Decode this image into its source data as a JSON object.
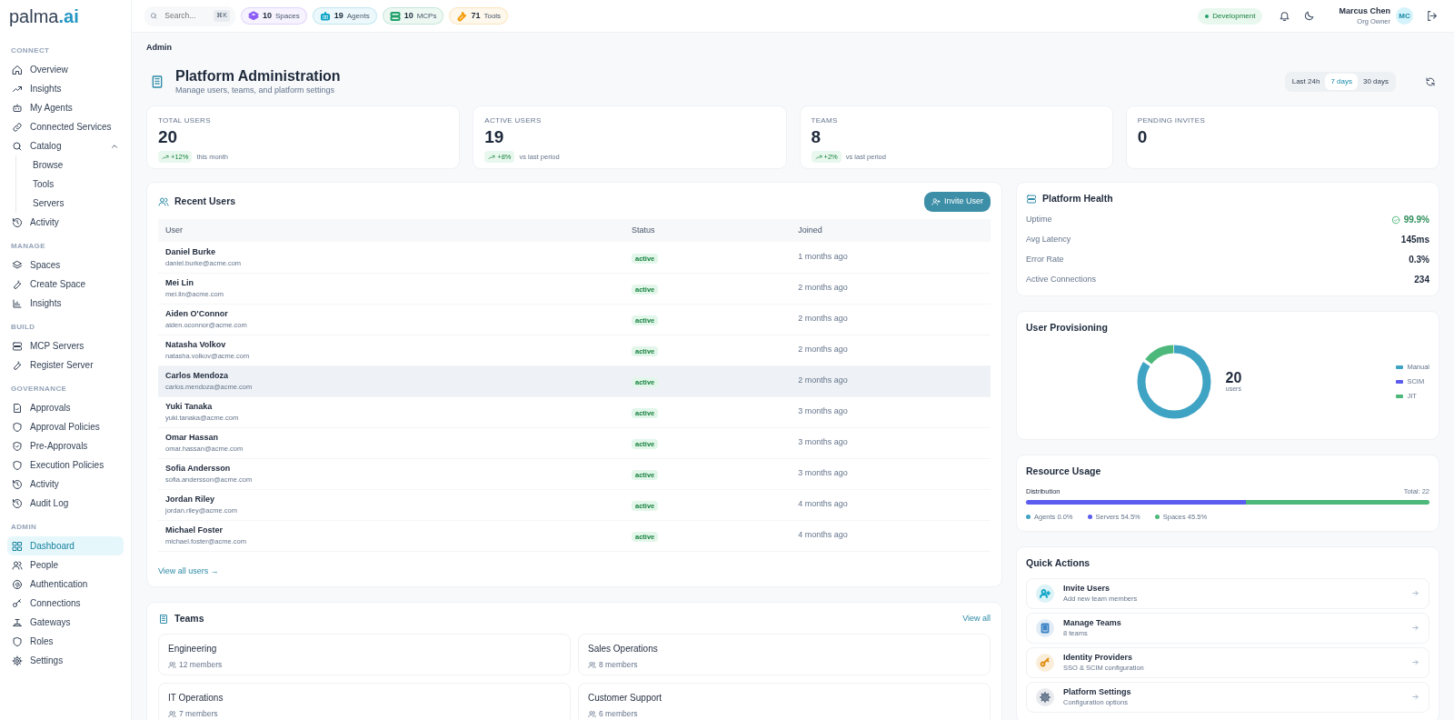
{
  "sidebar": {
    "brand": "palma",
    "brand_suffix": ".ai",
    "sections": [
      {
        "title": "CONNECT",
        "items": [
          {
            "label": "Overview",
            "selected": false
          },
          {
            "label": "Insights",
            "selected": false
          },
          {
            "label": "My Agents",
            "selected": false
          },
          {
            "label": "Connected Services",
            "selected": false
          },
          {
            "label": "Catalog",
            "selected": false,
            "expanded": true,
            "children": [
              {
                "label": "Browse",
                "selected": false
              },
              {
                "label": "Tools",
                "selected": false
              },
              {
                "label": "Servers",
                "selected": false
              }
            ]
          },
          {
            "label": "Activity",
            "selected": false
          }
        ]
      },
      {
        "title": "MANAGE",
        "items": [
          {
            "label": "Spaces",
            "selected": false
          },
          {
            "label": "Create Space",
            "selected": false
          },
          {
            "label": "Insights",
            "selected": false
          }
        ]
      },
      {
        "title": "BUILD",
        "items": [
          {
            "label": "MCP Servers",
            "selected": false
          },
          {
            "label": "Register Server",
            "selected": false
          }
        ]
      },
      {
        "title": "GOVERNANCE",
        "items": [
          {
            "label": "Approvals",
            "selected": false
          },
          {
            "label": "Approval Policies",
            "selected": false
          },
          {
            "label": "Pre-Approvals",
            "selected": false
          },
          {
            "label": "Execution Policies",
            "selected": false
          },
          {
            "label": "Activity",
            "selected": false
          },
          {
            "label": "Audit Log",
            "selected": false
          }
        ]
      },
      {
        "title": "ADMIN",
        "items": [
          {
            "label": "Dashboard",
            "selected": true
          },
          {
            "label": "People",
            "selected": false
          },
          {
            "label": "Authentication",
            "selected": false
          },
          {
            "label": "Connections",
            "selected": false
          },
          {
            "label": "Gateways",
            "selected": false
          },
          {
            "label": "Roles",
            "selected": false
          },
          {
            "label": "Settings",
            "selected": false
          }
        ]
      }
    ]
  },
  "topbar": {
    "search": {
      "placeholder": "Search...",
      "shortcut": "⌘K"
    },
    "chips": [
      {
        "count": "10",
        "label": "Spaces",
        "color": "#8b5cf6"
      },
      {
        "count": "19",
        "label": "Agents",
        "color": "#0ea5c6"
      },
      {
        "count": "10",
        "label": "MCPs",
        "color": "#22a06b"
      },
      {
        "count": "71",
        "label": "Tools",
        "color": "#f59e0b"
      }
    ],
    "environment": "Development",
    "user": {
      "name": "Marcus Chen",
      "role": "Org Owner",
      "initials": "MC"
    }
  },
  "breadcrumb": "Admin",
  "header": {
    "title": "Platform Administration",
    "subtitle": "Manage users, teams, and platform settings",
    "ranges": [
      {
        "label": "Last 24h",
        "selected": false
      },
      {
        "label": "7 days",
        "selected": true
      },
      {
        "label": "30 days",
        "selected": false
      }
    ]
  },
  "stats": [
    {
      "label": "TOTAL USERS",
      "value": "20",
      "change": "+12%",
      "note": "this month"
    },
    {
      "label": "ACTIVE USERS",
      "value": "19",
      "change": "+8%",
      "note": "vs last period"
    },
    {
      "label": "TEAMS",
      "value": "8",
      "change": "+2%",
      "note": "vs last period"
    },
    {
      "label": "PENDING INVITES",
      "value": "0"
    }
  ],
  "recent_users": {
    "title": "Recent Users",
    "button": "Invite User",
    "columns": [
      "User",
      "Status",
      "Joined"
    ],
    "rows": [
      {
        "name": "Daniel Burke",
        "email": "daniel.burke@acme.com",
        "status": "active",
        "joined": "1 months ago",
        "selected": false
      },
      {
        "name": "Mei Lin",
        "email": "mei.lin@acme.com",
        "status": "active",
        "joined": "2 months ago",
        "selected": false
      },
      {
        "name": "Aiden O'Connor",
        "email": "aiden.oconnor@acme.com",
        "status": "active",
        "joined": "2 months ago",
        "selected": false
      },
      {
        "name": "Natasha Volkov",
        "email": "natasha.volkov@acme.com",
        "status": "active",
        "joined": "2 months ago",
        "selected": false
      },
      {
        "name": "Carlos Mendoza",
        "email": "carlos.mendoza@acme.com",
        "status": "active",
        "joined": "2 months ago",
        "selected": true
      },
      {
        "name": "Yuki Tanaka",
        "email": "yuki.tanaka@acme.com",
        "status": "active",
        "joined": "3 months ago",
        "selected": false
      },
      {
        "name": "Omar Hassan",
        "email": "omar.hassan@acme.com",
        "status": "active",
        "joined": "3 months ago",
        "selected": false
      },
      {
        "name": "Sofia Andersson",
        "email": "sofia.andersson@acme.com",
        "status": "active",
        "joined": "3 months ago",
        "selected": false
      },
      {
        "name": "Jordan Riley",
        "email": "jordan.riley@acme.com",
        "status": "active",
        "joined": "4 months ago",
        "selected": false
      },
      {
        "name": "Michael Foster",
        "email": "michael.foster@acme.com",
        "status": "active",
        "joined": "4 months ago",
        "selected": false
      }
    ],
    "footer_link": "View all users →"
  },
  "teams": {
    "title": "Teams",
    "link": "View all",
    "items": [
      {
        "name": "Engineering",
        "members": "12 members"
      },
      {
        "name": "Sales Operations",
        "members": "8 members"
      },
      {
        "name": "IT Operations",
        "members": "7 members"
      },
      {
        "name": "Customer Support",
        "members": "6 members"
      }
    ]
  },
  "health": {
    "title": "Platform Health",
    "metrics": [
      {
        "label": "Uptime",
        "value": "99.9%",
        "kind": "status"
      },
      {
        "label": "Avg Latency",
        "value": "145ms",
        "kind": "metric"
      },
      {
        "label": "Error Rate",
        "value": "0.3%",
        "kind": "metric"
      },
      {
        "label": "Active Connections",
        "value": "234",
        "kind": "metric"
      }
    ]
  },
  "provisioning": {
    "title": "User Provisioning",
    "total": "20",
    "total_label": "users",
    "legend": [
      {
        "label": "Manual",
        "color": "#3fa3c4"
      },
      {
        "label": "SCIM",
        "color": "#5b5bf0"
      },
      {
        "label": "JIT",
        "color": "#4cb87a"
      }
    ]
  },
  "resources": {
    "title": "Resource Usage",
    "caption": "Distribution",
    "total": "Total: 22",
    "segments": [
      {
        "label": "Agents",
        "share": "0.0%",
        "level": 0,
        "color": "#3fa3c4"
      },
      {
        "label": "Servers",
        "share": "54.5%",
        "level": 0.545,
        "color": "#5b5bf0"
      },
      {
        "label": "Spaces",
        "share": "45.5%",
        "level": 0.455,
        "color": "#4cb87a"
      }
    ]
  },
  "quick_actions": {
    "title": "Quick Actions",
    "items": [
      {
        "title": "Invite Users",
        "subtitle": "Add new team members",
        "color": "#0ea5c6"
      },
      {
        "title": "Manage Teams",
        "subtitle": "8 teams",
        "color": "#3b82c4"
      },
      {
        "title": "Identity Providers",
        "subtitle": "SSO & SCIM configuration",
        "color": "#e08a0b"
      },
      {
        "title": "Platform Settings",
        "subtitle": "Configuration options",
        "color": "#64748b"
      }
    ]
  }
}
